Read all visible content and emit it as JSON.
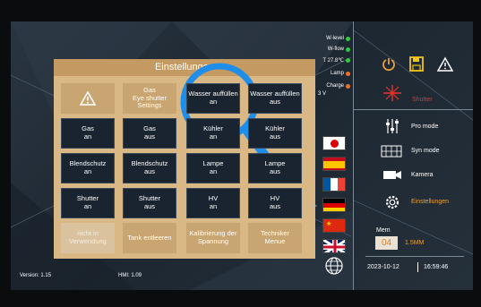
{
  "panel": {
    "title": "Einstellungen",
    "left_grid": [
      {
        "l1": "",
        "l2": "",
        "style": "tan",
        "icon": "warning"
      },
      {
        "l1": "Gas",
        "l2": "Eye shutter Settings",
        "style": "tan"
      },
      {
        "l1": "Gas",
        "l2": "an",
        "style": "dark"
      },
      {
        "l1": "Gas",
        "l2": "aus",
        "style": "dark"
      },
      {
        "l1": "Blendschutz",
        "l2": "an",
        "style": "dark"
      },
      {
        "l1": "Blendschutz",
        "l2": "aus",
        "style": "dark"
      },
      {
        "l1": "Shutter",
        "l2": "an",
        "style": "dark"
      },
      {
        "l1": "Shutter",
        "l2": "aus",
        "style": "dark"
      },
      {
        "l1": "nicht in",
        "l2": "Verwendung",
        "style": "light"
      },
      {
        "l1": "Tank entleeren",
        "l2": "",
        "style": "tan"
      }
    ],
    "right_grid": [
      {
        "l1": "Wasser auffüllen",
        "l2": "an",
        "style": "dark"
      },
      {
        "l1": "Wasser auffüllen",
        "l2": "aus",
        "style": "dark"
      },
      {
        "l1": "Kühler",
        "l2": "an",
        "style": "dark"
      },
      {
        "l1": "Kühler",
        "l2": "aus",
        "style": "dark"
      },
      {
        "l1": "Lampe",
        "l2": "an",
        "style": "dark"
      },
      {
        "l1": "Lampe",
        "l2": "aus",
        "style": "dark"
      },
      {
        "l1": "HV",
        "l2": "an",
        "style": "dark"
      },
      {
        "l1": "HV",
        "l2": "aus",
        "style": "dark"
      },
      {
        "l1": "Kalibrierung der Spannung",
        "l2": "",
        "style": "tan"
      },
      {
        "l1": "Techniker",
        "l2": "Menue",
        "style": "tan"
      }
    ]
  },
  "status": {
    "w_level": "W-level",
    "w_flow": "W-flow",
    "temp": "T 27.8℃",
    "lamp": "Lamp",
    "charge": "Charge",
    "charge_value": "3 V",
    "colors": {
      "green": "#2ecc40",
      "orange": "#e8742c"
    }
  },
  "languages": [
    "japanese-flag",
    "spanish-flag",
    "french-flag",
    "german-flag",
    "chinese-flag",
    "uk-flag"
  ],
  "right_menu": {
    "shutter": "Shutter",
    "pro_mode": "Pro mode",
    "syn_mode": "Syn mode",
    "kamera": "Kamera",
    "einstellungen": "Einstellungen",
    "mem_label": "Mem",
    "mem_value": "04",
    "mem_size": "1.5MM",
    "date": "2023-10-12",
    "time": "16:59:46"
  },
  "footer": {
    "version": "Version: 1.15",
    "hmi": "HMI: 1.09"
  }
}
